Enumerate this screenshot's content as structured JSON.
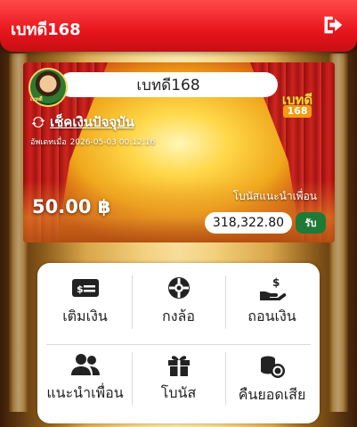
{
  "header": {
    "brand": "เบทดี168"
  },
  "card": {
    "avatar_name": "เบทดี",
    "username": "เบทดี168",
    "refresh_label": "เช็คเงินปัจจุบัน",
    "updated_label": "อัพเดทเมื่อ",
    "updated_time": "2026-05-03 00:12:16",
    "logo_text": "เบทดี",
    "logo_number": "168",
    "balance": "50.00 ฿",
    "referral_label": "โบนัสแนะนำเพื่อน",
    "referral_amount": "318,322.80",
    "claim_label": "รับ"
  },
  "menu": {
    "items": [
      {
        "label": "เติมเงิน",
        "icon": "deposit-card-icon"
      },
      {
        "label": "กงล้อ",
        "icon": "wheel-icon"
      },
      {
        "label": "ถอนเงิน",
        "icon": "withdraw-hand-icon"
      },
      {
        "label": "แนะนำเพื่อน",
        "icon": "users-icon"
      },
      {
        "label": "โบนัส",
        "icon": "gift-icon"
      },
      {
        "label": "คืนยอดเสีย",
        "icon": "coins-icon"
      }
    ]
  },
  "colors": {
    "header_red": "#e8151c",
    "claim_green": "#1f7a36",
    "icon_dark": "#222222"
  }
}
